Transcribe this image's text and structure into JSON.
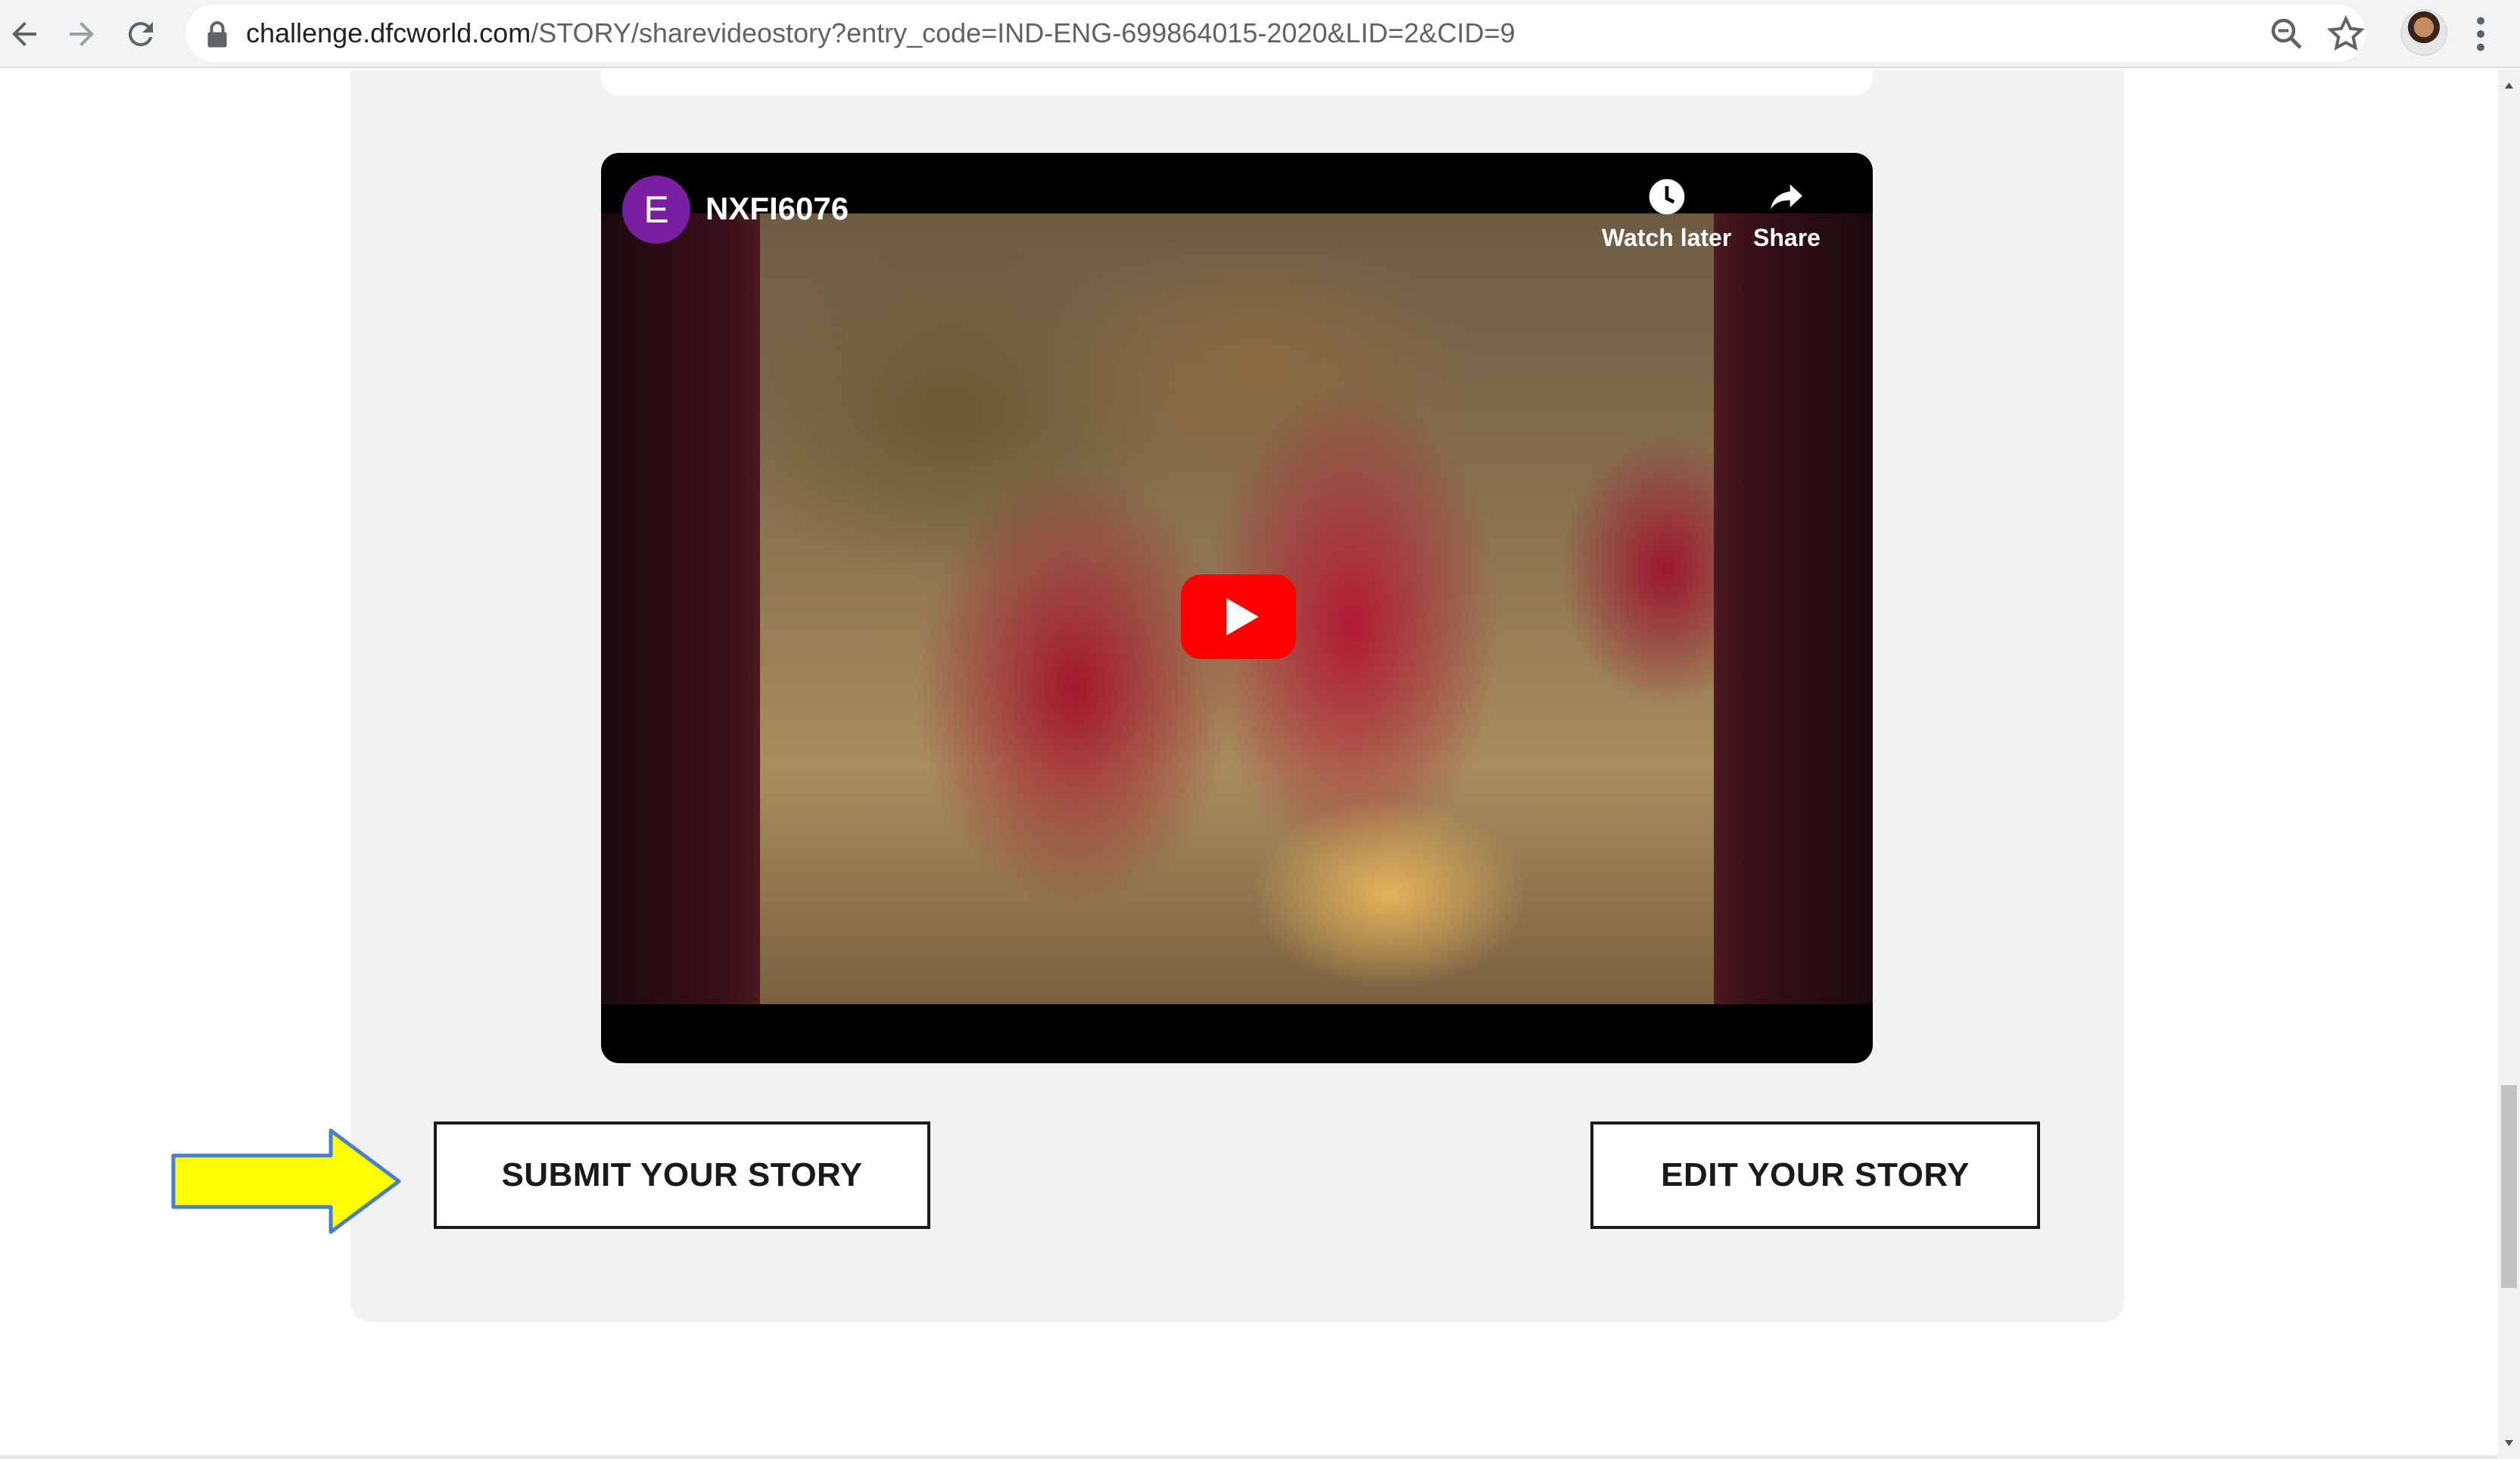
{
  "browser": {
    "url_host": "challenge.dfcworld.com",
    "url_path": "/STORY/sharevideostory?entry_code=IND-ENG-699864015-2020&LID=2&CID=9",
    "icons": [
      "back-icon",
      "forward-icon",
      "reload-icon",
      "lock-icon",
      "zoom-icon",
      "star-icon",
      "profile-avatar",
      "menu-icon"
    ]
  },
  "video": {
    "channel_initial": "E",
    "title": "NXFI6076",
    "watch_later_label": "Watch later",
    "share_label": "Share"
  },
  "actions": {
    "submit_label": "SUBMIT YOUR STORY",
    "edit_label": "EDIT YOUR STORY"
  },
  "colors": {
    "arrow_fill": "#ffff00",
    "arrow_stroke": "#4a7fd0",
    "play_button": "#ff0000",
    "channel_avatar": "#7b1fa2",
    "panel_bg": "#f2f2f4"
  }
}
